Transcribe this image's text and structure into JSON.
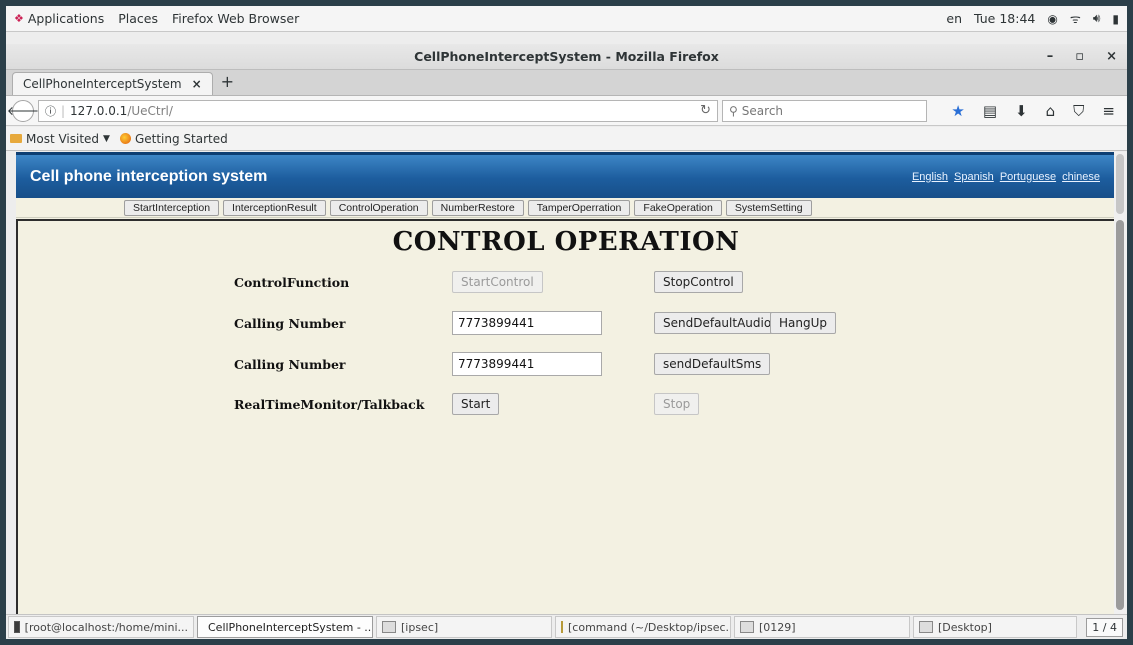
{
  "topbar": {
    "menus": [
      "Applications",
      "Places",
      "Firefox Web Browser"
    ],
    "lang": "en",
    "clock": "Tue 18:44",
    "icons": [
      "record-icon",
      "wifi-icon",
      "volume-icon",
      "battery-icon"
    ]
  },
  "window": {
    "title": "CellPhoneInterceptSystem - Mozilla Firefox",
    "minimize": "–",
    "maximize": "▫",
    "close": "×"
  },
  "tabs": [
    {
      "label": "CellPhoneInterceptSystem",
      "close": "×"
    }
  ],
  "newtab": "+",
  "nav": {
    "url_host": "127.0.0.1",
    "url_path": "/UeCtrl/",
    "search_placeholder": "Search"
  },
  "bookmarks": {
    "most_visited": "Most Visited",
    "getting_started": "Getting Started"
  },
  "site": {
    "title": "Cell phone interception system",
    "languages": [
      "English",
      "Spanish",
      "Portuguese",
      "chinese"
    ],
    "menu": [
      "StartInterception",
      "InterceptionResult",
      "ControlOperation",
      "NumberRestore",
      "TamperOperration",
      "FakeOperation",
      "SystemSetting"
    ]
  },
  "page": {
    "heading": "CONTROL OPERATION",
    "rows": [
      {
        "label": "ControlFunction",
        "btn1": "StartControl",
        "btn2": "StopControl"
      },
      {
        "label": "Calling Number",
        "value": "7773899441",
        "btn1": "SendDefaultAudio",
        "btn2": "HangUp"
      },
      {
        "label": "Calling Number",
        "value": "7773899441",
        "btn1": "sendDefaultSms"
      },
      {
        "label": "RealTimeMonitor/Talkback",
        "btn1": "Start",
        "btn2": "Stop"
      }
    ]
  },
  "taskbar": {
    "items": [
      "[root@localhost:/home/mini...",
      "CellPhoneInterceptSystem - ...",
      "[ipsec]",
      "[command (~/Desktop/ipsec...",
      "[0129]",
      "[Desktop]"
    ],
    "pager": "1 / 4"
  }
}
